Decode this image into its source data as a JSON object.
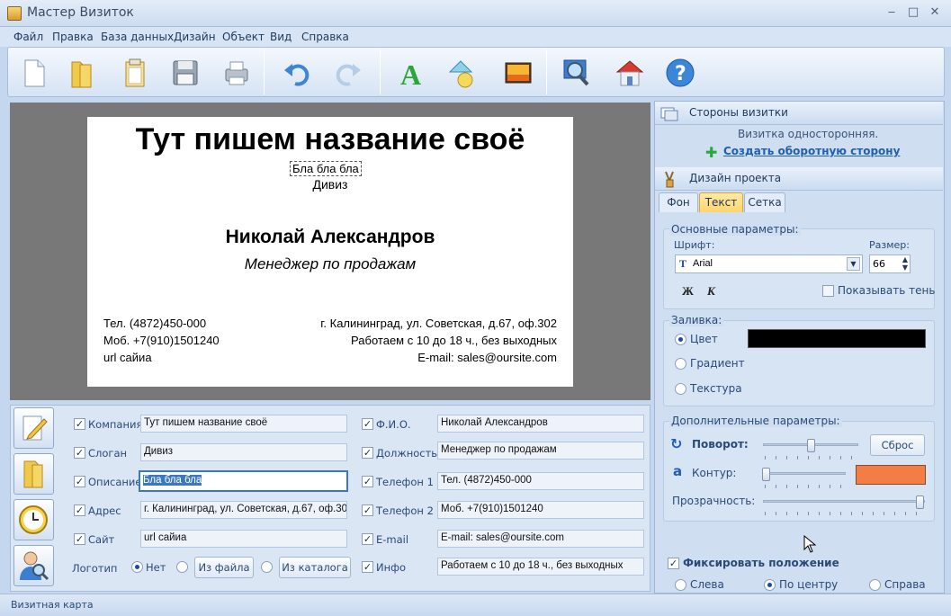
{
  "window": {
    "title": "Мастер Визиток",
    "minimize": "‒",
    "maximize": "□",
    "close": "✕"
  },
  "menu": [
    "Файл",
    "Правка",
    "База данных",
    "Дизайн",
    "Объект",
    "Вид",
    "Справка"
  ],
  "toolbar_icons": [
    "new-file-icon",
    "open-folder-icon",
    "templates-icon",
    "save-icon",
    "print-icon",
    "undo-icon",
    "redo-icon",
    "text-tool-icon",
    "shapes-icon",
    "image-icon",
    "zoom-icon",
    "home-icon",
    "help-icon"
  ],
  "card": {
    "company": "Тут пишем название своё",
    "description": "Бла бла бла",
    "slogan": "Дивиз",
    "name": "Николай Александров",
    "position": "Менеджер по продажам",
    "phone": "Тел. (4872)450-000",
    "mobile": "Моб. +7(910)1501240",
    "site": "url сайиа",
    "address": "г. Калининград, ул. Советская, д.67, оф.302",
    "hours": "Работаем с 10 до 18 ч., без выходных",
    "email": "E-mail: sales@oursite.com"
  },
  "fields_left": [
    {
      "label": "Компания",
      "value": "Тут пишем название своё"
    },
    {
      "label": "Слоган",
      "value": "Дивиз"
    },
    {
      "label": "Описание",
      "value": "Бла бла бла"
    },
    {
      "label": "Адрес",
      "value": "г. Калининград, ул. Советская, д.67, оф.302"
    },
    {
      "label": "Сайт",
      "value": "url сайиа"
    }
  ],
  "fields_right": [
    {
      "label": "Ф.И.О.",
      "value": "Николай Александров"
    },
    {
      "label": "Должность",
      "value": "Менеджер по продажам"
    },
    {
      "label": "Телефон 1",
      "value": "Тел. (4872)450-000"
    },
    {
      "label": "Телефон 2",
      "value": "Моб. +7(910)1501240"
    },
    {
      "label": "E-mail",
      "value": "E-mail: sales@oursite.com"
    },
    {
      "label": "Инфо",
      "value": "Работаем с 10 до 18 ч., без выходных"
    }
  ],
  "logo": {
    "label": "Логотип",
    "none": "Нет",
    "from_file": "Из файла",
    "from_catalog": "Из каталога"
  },
  "sides": {
    "header": "Стороны визитки",
    "info": "Визитка односторонняя.",
    "create_back": "Создать оборотную сторону"
  },
  "design": {
    "header": "Дизайн проекта",
    "tabs": [
      "Фон",
      "Текст",
      "Сетка"
    ],
    "active_tab": "Текст"
  },
  "basic": {
    "title": "Основные параметры:",
    "font_label": "Шрифт:",
    "font_value": "Arial",
    "size_label": "Размер:",
    "size_value": "66",
    "bold": "Ж",
    "italic": "К",
    "shadow": "Показывать тень"
  },
  "fill": {
    "title": "Заливка:",
    "color": "Цвет",
    "gradient": "Градиент",
    "texture": "Текстура",
    "color_value": "#000000"
  },
  "extra": {
    "title": "Дополнительные параметры:",
    "rotate": "Поворот:",
    "reset": "Сброс",
    "outline": "Контур:",
    "outline_color": "#f47c45",
    "transparency": "Прозрачность:"
  },
  "fix": {
    "label": "Фиксировать положение",
    "left": "Слева",
    "center": "По центру",
    "right": "Справа"
  },
  "status": "Визитная карта"
}
